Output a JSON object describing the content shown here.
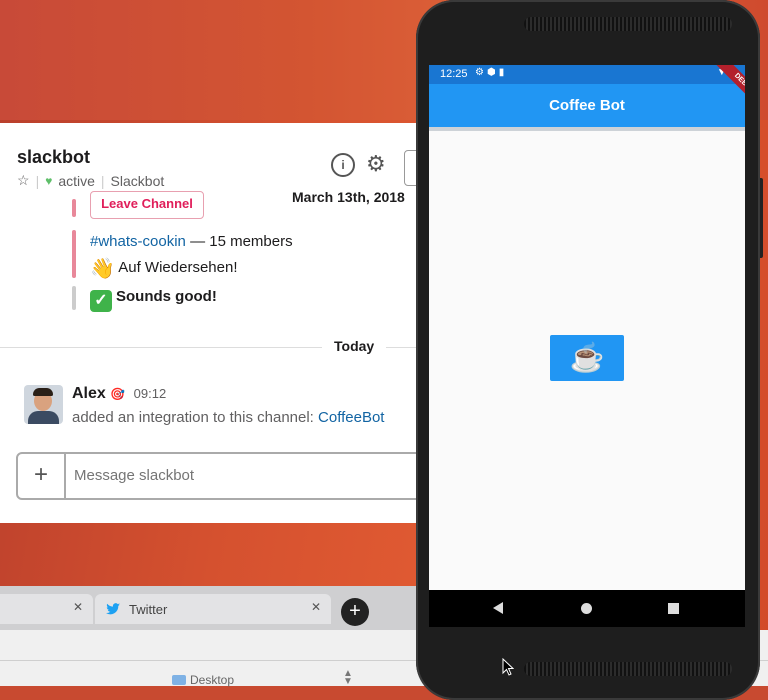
{
  "slack": {
    "channel_title": "slackbot",
    "status": "active",
    "workspace": "Slackbot",
    "date_divider": "March 13th, 2018",
    "leave_button": "Leave Channel",
    "channel_link": "#whats-cookin",
    "channel_members": "— 15 members",
    "wave_text": "Auf Wiedersehen!",
    "sounds_good": "Sounds good!",
    "today_divider": "Today",
    "message": {
      "author": "Alex",
      "time": "09:12",
      "text": "added an integration to this channel:",
      "link": "CoffeeBot"
    },
    "composer_placeholder": "Message slackbot"
  },
  "browser": {
    "tab_twitter": "Twitter",
    "bottom_location": "Desktop"
  },
  "phone": {
    "status_time": "12:25",
    "app_title": "Coffee Bot",
    "debug_banner": "DEBUG",
    "button_icon": "coffee-cup-icon"
  },
  "colors": {
    "slack_link": "#1264a3",
    "leave_red": "#e01e5a",
    "android_primary": "#2196f3",
    "android_status": "#1976d2"
  }
}
